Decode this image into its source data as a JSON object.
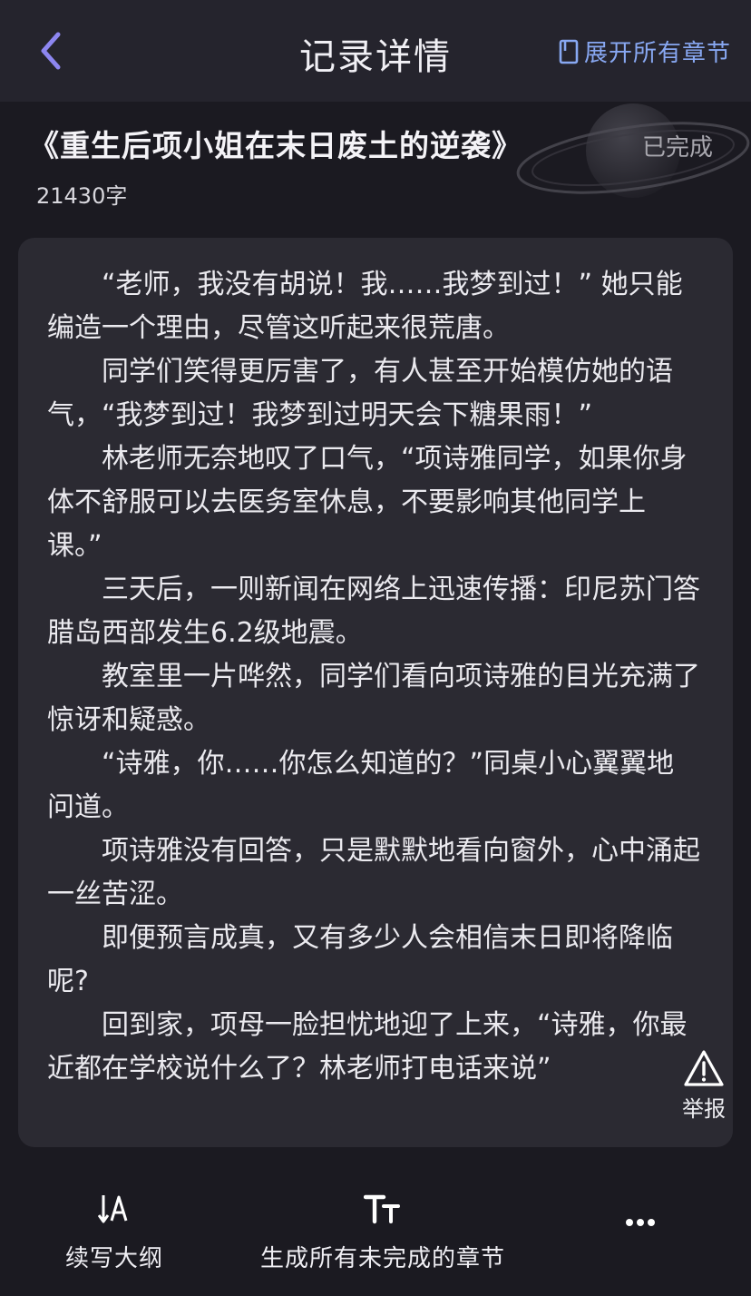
{
  "header": {
    "title": "记录详情",
    "expand_label": "展开所有章节"
  },
  "book": {
    "title": "《重生后项小姐在末日废土的逆袭》",
    "status": "已完成",
    "word_count": "21430字"
  },
  "content": {
    "paragraphs": [
      "“老师，我没有胡说！我……我梦到过！” 她只能编造一个理由，尽管这听起来很荒唐。",
      "同学们笑得更厉害了，有人甚至开始模仿她的语气，“我梦到过！我梦到过明天会下糖果雨！”",
      "林老师无奈地叹了口气，“项诗雅同学，如果你身体不舒服可以去医务室休息，不要影响其他同学上课。”",
      "三天后，一则新闻在网络上迅速传播：印尼苏门答腊岛西部发生6.2级地震。",
      "教室里一片哗然，同学们看向项诗雅的目光充满了惊讶和疑惑。",
      "“诗雅，你……你怎么知道的？”同桌小心翼翼地问道。",
      "项诗雅没有回答，只是默默地看向窗外，心中涌起一丝苦涩。",
      "即便预言成真，又有多少人会相信末日即将降临呢?",
      "回到家，项母一脸担忧地迎了上来，“诗雅，你最近都在学校说什么了？林老师打电话来说”"
    ],
    "report_label": "举报"
  },
  "bottom_bar": {
    "continue_outline_label": "续写大纲",
    "generate_all_label": "生成所有未完成的章节"
  },
  "colors": {
    "background": "#1b1a21",
    "header_bg": "#25242d",
    "card_bg": "#2b2a32",
    "accent": "#88a8f2",
    "back_arrow": "#8d86f0"
  }
}
